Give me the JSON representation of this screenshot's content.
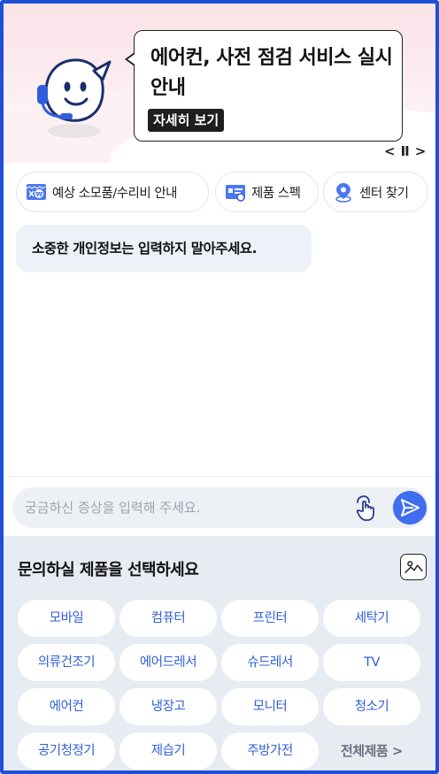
{
  "banner": {
    "title": "에어컨, 사전 점검 서비스 실시 안내",
    "detail_button": "자세히 보기",
    "slide_prev": "<",
    "slide_pause": "II",
    "slide_next": ">"
  },
  "quick_links": [
    {
      "label": "예상 소모품/수리비 안내",
      "icon": "cost-icon"
    },
    {
      "label": "제품 스펙",
      "icon": "spec-card-icon"
    },
    {
      "label": "센터 찾기",
      "icon": "location-pin-icon"
    }
  ],
  "notice": "소중한 개인정보는 입력하지 말아주세요.",
  "input": {
    "placeholder": "궁금하신 증상을 입력해 주세요.",
    "value": ""
  },
  "products": {
    "title": "문의하실 제품을 선택하세요",
    "items": [
      "모바일",
      "컴퓨터",
      "프린터",
      "세탁기",
      "의류건조기",
      "에어드레서",
      "슈드레서",
      "TV",
      "에어컨",
      "냉장고",
      "모니터",
      "청소기",
      "공기청정기",
      "제습기",
      "주방가전"
    ],
    "all_label": "전체제품 >"
  },
  "colors": {
    "accent": "#3f6ef0",
    "frame": "#1f4fd6",
    "product_text": "#2f5fd8",
    "panel_bg": "#e7ecf3"
  }
}
